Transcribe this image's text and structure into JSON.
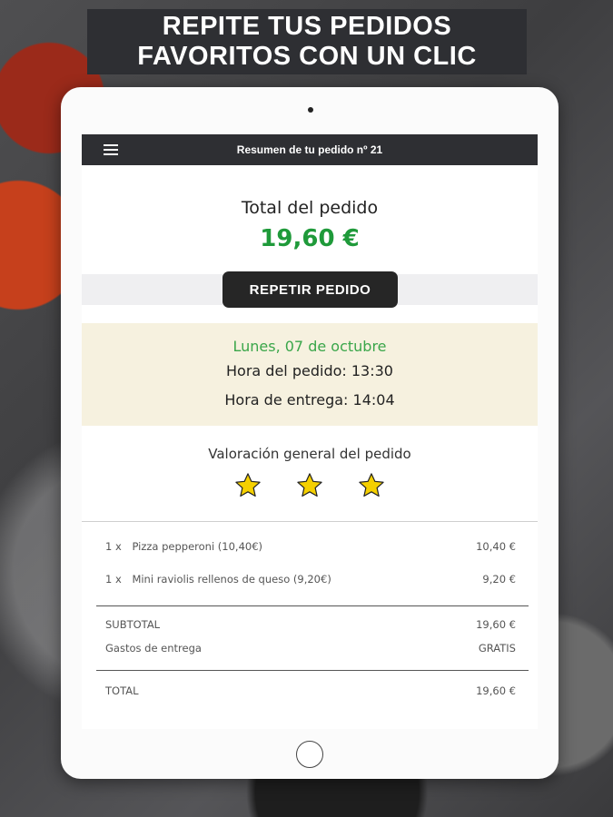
{
  "banner": {
    "line1": "REPITE TUS PEDIDOS",
    "line2": "FAVORITOS CON UN CLIC"
  },
  "appbar": {
    "title": "Resumen de tu pedido nº 21",
    "menu_icon": "hamburger-menu-icon"
  },
  "order": {
    "total_label": "Total del pedido",
    "total_value": "19,60 €",
    "repeat_label": "REPETIR PEDIDO",
    "date": "Lunes, 07 de octubre",
    "order_time": "Hora del pedido: 13:30",
    "delivery_time": "Hora de entrega: 14:04"
  },
  "rating": {
    "title": "Valoración general del pedido",
    "stars": 3,
    "star_color": "#f5d000"
  },
  "items": [
    {
      "qty": "1 x",
      "name": "Pizza pepperoni (10,40€)",
      "price": "10,40 €"
    },
    {
      "qty": "1 x",
      "name": "Mini raviolis rellenos de queso   (9,20€)",
      "price": "9,20 €"
    }
  ],
  "totals": {
    "subtotal_label": "SUBTOTAL",
    "subtotal_value": "19,60 €",
    "delivery_label": "Gastos de entrega",
    "delivery_value": "GRATIS",
    "total_label": "TOTAL",
    "total_value": "19,60 €"
  },
  "colors": {
    "accent_green": "#1f9a3a",
    "dark_bar": "#2e2f33",
    "date_band": "#f6f1df"
  }
}
